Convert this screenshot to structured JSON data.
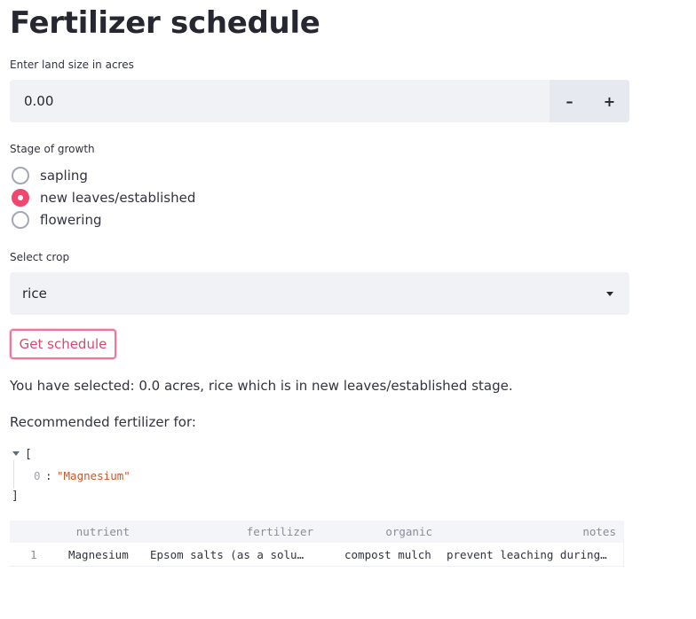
{
  "page": {
    "title": "Fertilizer schedule"
  },
  "land": {
    "label": "Enter land size in acres",
    "value": "0.00",
    "decrement": "–",
    "increment": "+"
  },
  "stage": {
    "label": "Stage of growth",
    "options": [
      {
        "label": "sapling",
        "selected": false
      },
      {
        "label": "new leaves/established",
        "selected": true
      },
      {
        "label": "flowering",
        "selected": false
      }
    ]
  },
  "crop": {
    "label": "Select crop",
    "value": "rice"
  },
  "button": {
    "label": "Get schedule"
  },
  "summary": {
    "selected_text": "You have selected: 0.0 acres, rice which is in new leaves/established stage.",
    "recommended_text": "Recommended fertilizer for:"
  },
  "json_view": {
    "open": "[",
    "close": "]",
    "index": "0",
    "sep": ":",
    "value": "\"Magnesium\""
  },
  "table": {
    "columns": [
      "nutrient",
      "fertilizer",
      "organic",
      "notes"
    ],
    "rows": [
      {
        "index": "1",
        "cells": [
          "Magnesium",
          "Epsom salts (as a solu…",
          "compost mulch",
          "prevent leaching during…"
        ]
      }
    ]
  },
  "colors": {
    "accent": "#f04670",
    "input_bg": "#f0f2f6",
    "json_string": "#c4582c"
  }
}
